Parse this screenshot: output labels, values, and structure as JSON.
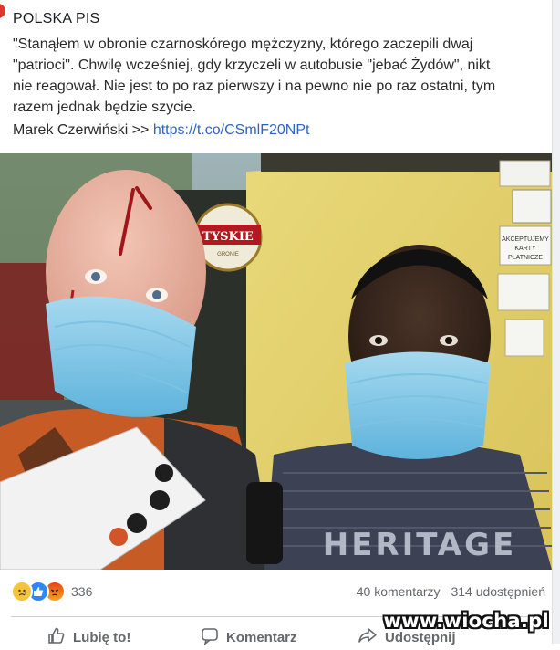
{
  "post": {
    "page_name": "POLSKA PIS",
    "text_lines": [
      "\"Stanąłem w obronie czarnoskórego mężczyzny, którego zaczepili dwaj",
      "\"patrioci\". Chwilę wcześniej, gdy krzyczeli w autobusie \"jebać Żydów\", nikt",
      "nie reagował. Nie jest to po raz pierwszy i na pewno nie po raz ostatni, tym",
      "razem jednak będzie szycie."
    ],
    "source_prefix": "Marek Czerwiński >> ",
    "source_link": "https://t.co/CSmlF20NPt"
  },
  "photo": {
    "sign_text": "TYSKIE",
    "sign_subtext": "GRONIE",
    "card_sign_text": "AKCEPTUJEMY KARTY PŁATNICZE",
    "shirt_text": "HERITAGE"
  },
  "engagement": {
    "reaction_icons": [
      "sad-emoji",
      "like-thumb",
      "angry-emoji"
    ],
    "reaction_count": "336",
    "comments": "40 komentarzy",
    "shares": "314 udostępnień"
  },
  "actions": {
    "like_label": "Lubię to!",
    "comment_label": "Komentarz",
    "share_label": "Udostępnij"
  },
  "watermark": "www.wiocha.pl",
  "colors": {
    "link": "#2f64c7",
    "like": "#2d88ff",
    "muted": "#65676b"
  }
}
